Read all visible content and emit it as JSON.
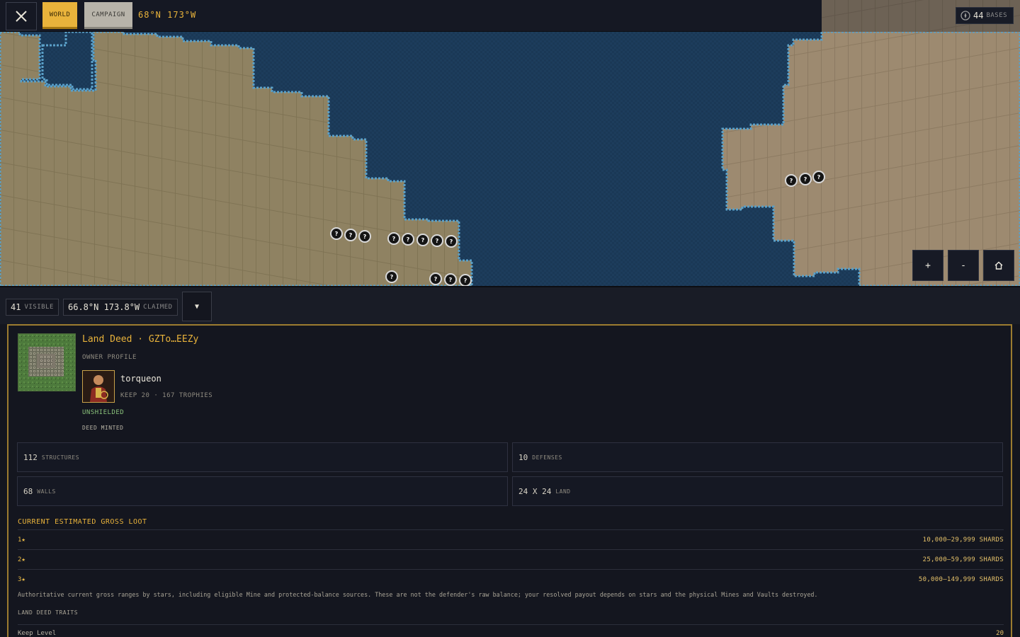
{
  "topbar": {
    "close_icon": "close-icon",
    "tabs": [
      {
        "label": "WORLD",
        "active": true
      },
      {
        "label": "CAMPAIGN",
        "active": false
      }
    ],
    "coordinates": "68°N 173°W",
    "bases": {
      "icon": "compass-icon",
      "count": "44",
      "label": "BASES"
    }
  },
  "map": {
    "markers": [
      "?",
      "?",
      "?",
      "?",
      "?",
      "?",
      "?",
      "?",
      "?",
      "?",
      "?",
      "?",
      "?",
      "?",
      "?"
    ],
    "controls": {
      "zoom_in": "+",
      "zoom_out": "-",
      "home_icon": "home-icon"
    },
    "colors": {
      "water": "#1d3d5c",
      "land_west": "#8f8262",
      "land_east": "#9d8a70",
      "shore": "#5aa0c8"
    }
  },
  "strip": {
    "visible": {
      "count": "41",
      "label": "VISIBLE"
    },
    "claimed": {
      "coords": "66.8°N 173.8°W",
      "label": "CLAIMED"
    },
    "dropdown_icon": "▼"
  },
  "deed": {
    "title": "Land Deed · GZTo…EEZy",
    "owner_label": "OWNER PROFILE",
    "owner": {
      "name": "torqueon",
      "meta": "KEEP 20 · 167 TROPHIES"
    },
    "status": "UNSHIELDED",
    "minted": "DEED MINTED",
    "stats": [
      {
        "value": "112",
        "label": "STRUCTURES"
      },
      {
        "value": "10",
        "label": "DEFENSES"
      },
      {
        "value": "68",
        "label": "WALLS"
      },
      {
        "value": "24 X 24",
        "label": "LAND"
      }
    ],
    "loot": {
      "title": "CURRENT ESTIMATED GROSS LOOT",
      "rows": [
        {
          "stars": "1★",
          "value": "10,000–29,999 SHARDS"
        },
        {
          "stars": "2★",
          "value": "25,000–59,999 SHARDS"
        },
        {
          "stars": "3★",
          "value": "50,000–149,999 SHARDS"
        }
      ],
      "note": "Authoritative current gross ranges by stars, including eligible Mine and protected-balance sources. These are not the defender's raw balance; your resolved payout depends on stars and the physical Mines and Vaults destroyed."
    },
    "traits": {
      "title": "LAND DEED TRAITS",
      "rows": [
        {
          "label": "Keep Level",
          "value": "20"
        }
      ]
    }
  }
}
